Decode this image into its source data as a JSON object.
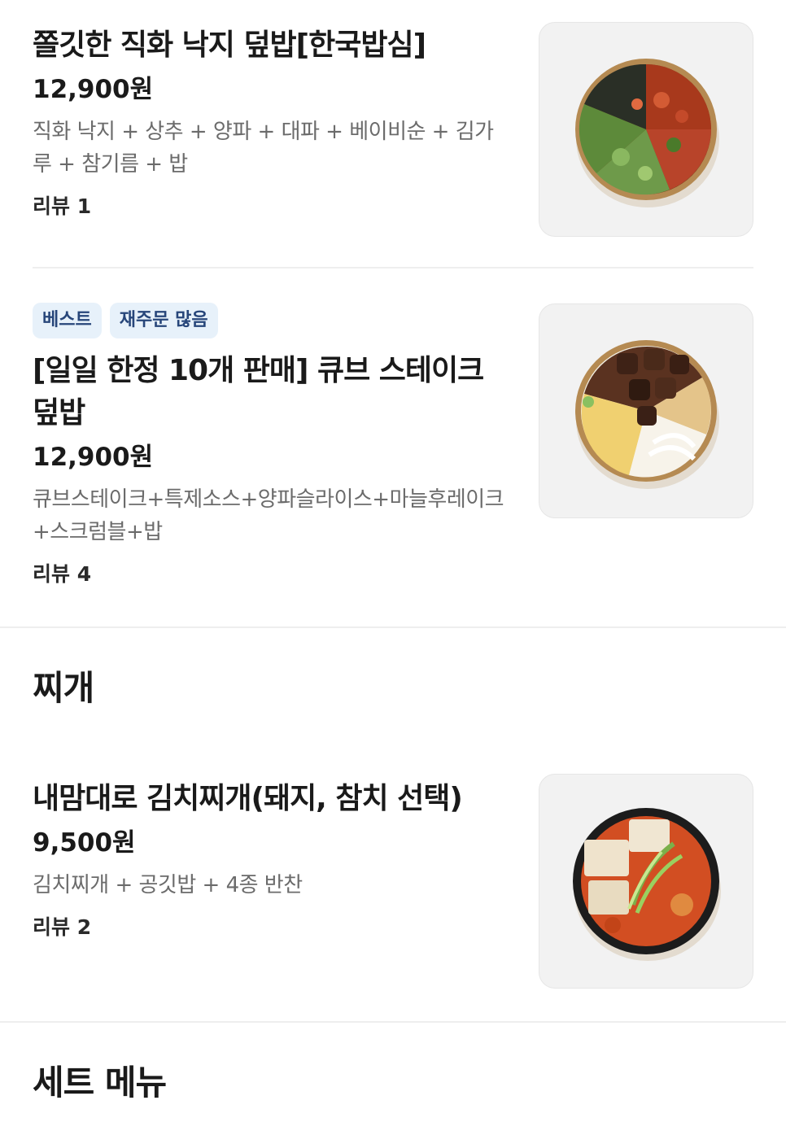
{
  "items": [
    {
      "name": "쫄깃한 직화 낙지 덮밥[한국밥심]",
      "price": "12,900원",
      "description": "직화 낙지 + 상추 + 양파 + 대파 + 베이비순 + 김가루 + 참기름 + 밥",
      "review": "리뷰 1",
      "image_icon": "octopus-rice-bowl-photo"
    },
    {
      "badges": [
        "베스트",
        "재주문 많음"
      ],
      "name": "[일일 한정 10개 판매] 큐브 스테이크 덮밥",
      "price": "12,900원",
      "description": "큐브스테이크+특제소스+양파슬라이스+마늘후레이크+스크럼블+밥",
      "review": "리뷰 4",
      "image_icon": "cube-steak-rice-bowl-photo"
    },
    {
      "name": "내맘대로 김치찌개(돼지, 참치 선택)",
      "price": "9,500원",
      "description": "김치찌개 + 공깃밥 + 4종 반찬",
      "review": "리뷰 2",
      "image_icon": "kimchi-stew-photo"
    }
  ],
  "sections": {
    "stew": "찌개",
    "set_menu": "세트 메뉴"
  },
  "colors": {
    "badge_bg": "#e7f1fa",
    "badge_text": "#27467a",
    "description": "#6b6b6b",
    "divider": "#eeeeee"
  }
}
